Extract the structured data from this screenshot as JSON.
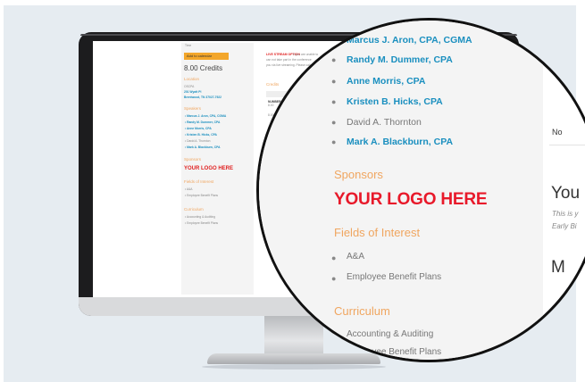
{
  "screen": {
    "top_label": "Time",
    "add_calendar": "Add to calendar",
    "credits": "8.00 Credits",
    "location_heading": "Location",
    "location_name": "OSCPA",
    "location_address1": "201 Wyatt Pl",
    "location_address2": "Brentwood, TN 37027-7922",
    "speakers_heading": "Speakers",
    "speakers": [
      "Marcus J. Aron, CPA, CGMA",
      "Randy M. Dummer, CPA",
      "Anne Morris, CPA",
      "Kristen B. Hicks, CPA",
      "David A. Thornton",
      "Mark A. Blackburn, CPA"
    ],
    "sponsors_heading": "Sponsors",
    "sponsor_logo": "YOUR LOGO HERE",
    "fields_heading": "Fields of Interest",
    "fields": [
      "A&A",
      "Employee Benefit Plans"
    ],
    "curriculum_heading": "Curriculum",
    "curriculum": [
      "Accounting & Auditing",
      "Employee Benefit Plans"
    ],
    "livestream_label": "LIVE STREAM OPTION",
    "livestream_text1": "If you are unable to",
    "livestream_text2": "can not take part in the conference",
    "livestream_text3": "you via live streaming. Please call",
    "credits_heading": "Credits",
    "number_of_label": "NUMBER OF",
    "credit_row1": "8.00",
    "credit_row2": "8.00"
  },
  "lens": {
    "speakers": [
      "Marcus J. Aron, CPA, CGMA",
      "Randy M. Dummer, CPA",
      "Anne Morris, CPA",
      "Kristen B. Hicks, CPA",
      "David A. Thornton",
      "Mark A. Blackburn, CPA"
    ],
    "sponsors_heading": "Sponsors",
    "sponsor_logo": "YOUR LOGO HERE",
    "fields_heading": "Fields of Interest",
    "fields": [
      "A&A",
      "Employee Benefit Plans"
    ],
    "curriculum_heading": "Curriculum",
    "curriculum": [
      "Accounting & Auditing",
      "Employee Benefit Plans"
    ],
    "right_no": "No",
    "right_you": "You",
    "right_this_is": "This is y",
    "right_early": "Early Bi",
    "right_m": "M"
  }
}
